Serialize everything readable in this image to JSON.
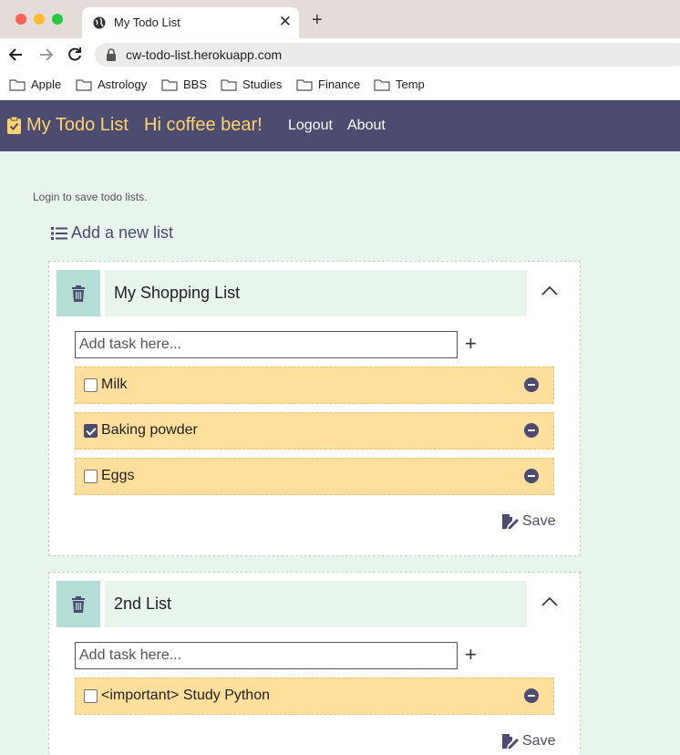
{
  "browser": {
    "tab_title": "My Todo List",
    "url": "cw-todo-list.herokuapp.com",
    "bookmarks": [
      "Apple",
      "Astrology",
      "BBS",
      "Studies",
      "Finance",
      "Temp"
    ]
  },
  "nav": {
    "brand": "My Todo List",
    "greeting": "Hi coffee bear!",
    "logout": "Logout",
    "about": "About"
  },
  "main": {
    "login_note": "Login to save todo lists.",
    "add_list": "Add a new list",
    "task_placeholder": "Add task here...",
    "save_label": "Save",
    "lists": [
      {
        "title": "My Shopping List",
        "tasks": [
          {
            "label": "Milk",
            "checked": false
          },
          {
            "label": "Baking powder",
            "checked": true
          },
          {
            "label": "Eggs",
            "checked": false
          }
        ]
      },
      {
        "title": "2nd List",
        "tasks": [
          {
            "label": "<important> Study Python",
            "checked": false
          }
        ]
      }
    ]
  },
  "colors": {
    "nav_bg": "#4b4c6f",
    "brand_yellow": "#ffd36e",
    "page_bg": "#e8f5ec",
    "task_bg": "#ffdf9b",
    "delete_bg": "#b4ddd6"
  }
}
